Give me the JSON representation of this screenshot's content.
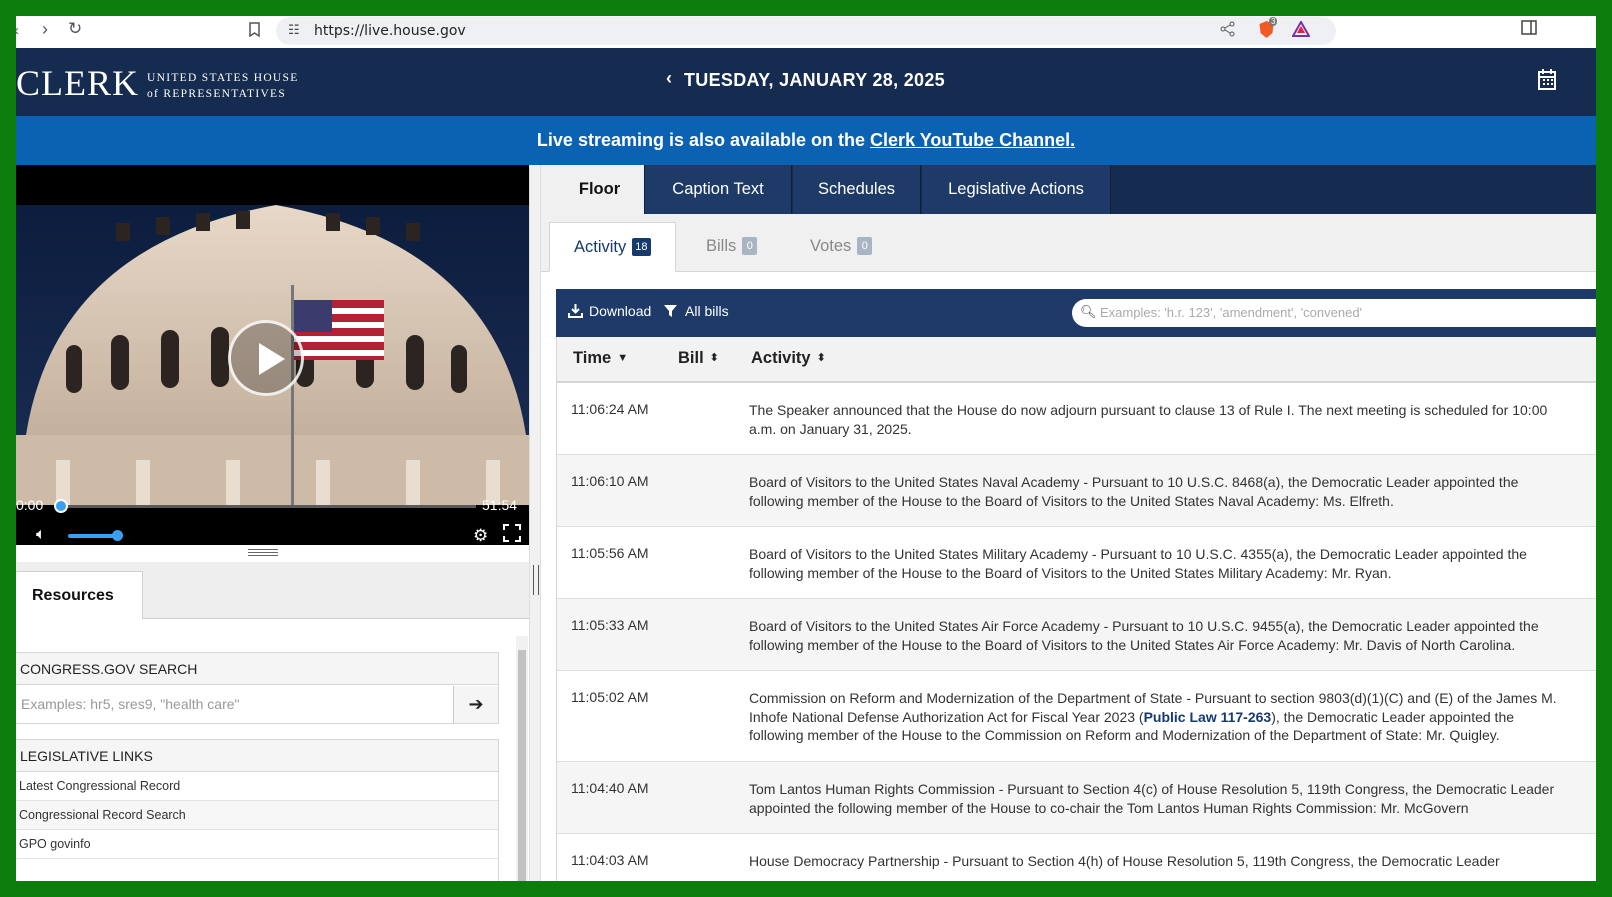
{
  "browser": {
    "url": "https://live.house.gov",
    "back_icon": "chevron-left-icon",
    "forward_icon": "chevron-right-icon",
    "reload_icon": "reload-icon",
    "bookmark_icon": "bookmark-icon",
    "share_icon": "share-icon",
    "brave_badge": "3"
  },
  "header": {
    "logo_word": "CLERK",
    "logo_line1": "UNITED STATES HOUSE",
    "logo_line2": "of REPRESENTATIVES",
    "date": "TUESDAY, JANUARY 28, 2025",
    "colors": {
      "header_bg": "#152b50",
      "banner_bg": "#0b62b2"
    }
  },
  "banner": {
    "text_prefix": "Live streaming is also available on the ",
    "link_text": "Clerk YouTube Channel."
  },
  "video": {
    "time_current": "0:00",
    "time_total": "51:54",
    "progress": 0.0,
    "volume": 0.9
  },
  "resources": {
    "tab_label": "Resources",
    "search": {
      "heading": "CONGRESS.GOV SEARCH",
      "placeholder": "Examples: hr5, sres9, \"health care\""
    },
    "links": {
      "heading": "LEGISLATIVE LINKS",
      "items": [
        "Latest Congressional Record",
        "Congressional Record Search",
        "GPO govinfo"
      ]
    }
  },
  "main_tabs": [
    {
      "label": "Floor",
      "active": true
    },
    {
      "label": "Caption Text",
      "active": false
    },
    {
      "label": "Schedules",
      "active": false
    },
    {
      "label": "Legislative Actions",
      "active": false
    }
  ],
  "sub_tabs": [
    {
      "label": "Activity",
      "count": "18",
      "active": true
    },
    {
      "label": "Bills",
      "count": "0",
      "active": false
    },
    {
      "label": "Votes",
      "count": "0",
      "active": false
    }
  ],
  "toolbar": {
    "download_label": "Download",
    "filter_label": "All bills",
    "search_placeholder": "Examples: 'h.r. 123', 'amendment', 'convened'"
  },
  "table": {
    "columns": [
      "Time",
      "Bill",
      "Activity"
    ],
    "rows": [
      {
        "time": "11:06:24 AM",
        "bill": "",
        "text": "The Speaker announced that the House do now adjourn pursuant to clause 13 of Rule I. The next meeting is scheduled for 10:00\na.m. on January 31, 2025."
      },
      {
        "time": "11:06:10 AM",
        "bill": "",
        "text": "Board of Visitors to the United States Naval Academy - Pursuant to 10 U.S.C. 8468(a), the Democratic Leader appointed the\nfollowing member of the House to the Board of Visitors to the United States Naval Academy: Ms. Elfreth."
      },
      {
        "time": "11:05:56 AM",
        "bill": "",
        "text": "Board of Visitors to the United States Military Academy - Pursuant to 10 U.S.C. 4355(a), the Democratic Leader appointed the\nfollowing member of the House to the Board of Visitors to the United States Military Academy: Mr. Ryan."
      },
      {
        "time": "11:05:33 AM",
        "bill": "",
        "text": "Board of Visitors to the United States Air Force Academy - Pursuant to 10 U.S.C. 9455(a), the Democratic Leader appointed the\nfollowing member of the House to the Board of Visitors to the United States Air Force Academy: Mr. Davis of North Carolina."
      },
      {
        "time": "11:05:02 AM",
        "bill": "",
        "text_before": "Commission on Reform and Modernization of the Department of State - Pursuant to section 9803(d)(1)(C) and (E) of the James M.\nInhofe National Defense Authorization Act for Fiscal Year 2023 (",
        "link": "Public Law 117-263",
        "text_after": "), the Democratic Leader appointed the\nfollowing member of the House to the Commission on Reform and Modernization of the Department of State: Mr. Quigley."
      },
      {
        "time": "11:04:40 AM",
        "bill": "",
        "text": "Tom Lantos Human Rights Commission - Pursuant to Section 4(c) of House Resolution 5, 119th Congress, the Democratic Leader\nappointed the following member of the House to co-chair the Tom Lantos Human Rights Commission: Mr. McGovern"
      },
      {
        "time": "11:04:03 AM",
        "bill": "",
        "text": "House Democracy Partnership - Pursuant to Section 4(h) of House Resolution 5, 119th Congress, the Democratic Leader"
      }
    ]
  }
}
